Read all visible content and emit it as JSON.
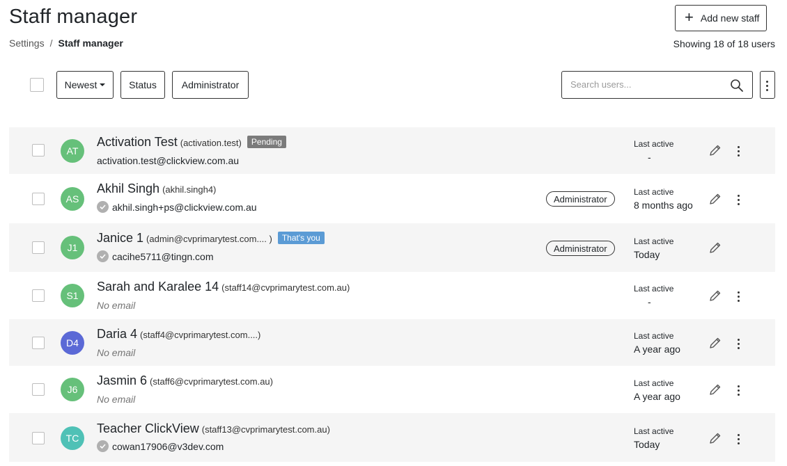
{
  "header": {
    "title": "Staff manager",
    "breadcrumb": {
      "parent": "Settings",
      "separator": "/",
      "current": "Staff manager"
    },
    "add_button": {
      "icon": "plus-icon",
      "label": "Add new staff"
    },
    "showing": "Showing 18 of 18 users"
  },
  "toolbar": {
    "sort_label": "Newest",
    "status_label": "Status",
    "admin_label": "Administrator",
    "search_placeholder": "Search users..."
  },
  "colors": {
    "avatar_green": "#66c07a",
    "avatar_blue": "#5b69d6",
    "avatar_teal": "#4fc1b6",
    "pending_tag": "#7b7b7b",
    "you_tag": "#5b9bd5",
    "row_shade": "#f5f5f5"
  },
  "users": [
    {
      "initials": "AT",
      "name": "Activation Test",
      "username": "(activation.test)",
      "tag": "Pending",
      "email": "activation.test@clickview.com.au",
      "verified": false,
      "no_email": false,
      "role": "",
      "last_active_label": "Last active",
      "last_active": "-"
    },
    {
      "initials": "AS",
      "name": "Akhil Singh",
      "username": "(akhil.singh4)",
      "tag": "",
      "email": "akhil.singh+ps@clickview.com.au",
      "verified": true,
      "no_email": false,
      "role": "Administrator",
      "last_active_label": "Last active",
      "last_active": "8 months ago"
    },
    {
      "initials": "J1",
      "name": "Janice 1",
      "username": "(admin@cvprimarytest.com.... )",
      "tag": "That's you",
      "email": "cacihe5711@tingn.com",
      "verified": true,
      "no_email": false,
      "role": "Administrator",
      "last_active_label": "Last active",
      "last_active": "Today"
    },
    {
      "initials": "S1",
      "name": "Sarah and Karalee 14",
      "username": "(staff14@cvprimarytest.com.au)",
      "tag": "",
      "email": "No email",
      "verified": false,
      "no_email": true,
      "role": "",
      "last_active_label": "Last active",
      "last_active": "-"
    },
    {
      "initials": "D4",
      "name": "Daria 4",
      "username": "(staff4@cvprimarytest.com....)",
      "tag": "",
      "email": "No email",
      "verified": false,
      "no_email": true,
      "role": "",
      "last_active_label": "Last active",
      "last_active": "A year ago"
    },
    {
      "initials": "J6",
      "name": "Jasmin 6",
      "username": "(staff6@cvprimarytest.com.au)",
      "tag": "",
      "email": "No email",
      "verified": false,
      "no_email": true,
      "role": "",
      "last_active_label": "Last active",
      "last_active": "A year ago"
    },
    {
      "initials": "TC",
      "name": "Teacher ClickView",
      "username": "(staff13@cvprimarytest.com.au)",
      "tag": "",
      "email": "cowan17906@v3dev.com",
      "verified": true,
      "no_email": false,
      "role": "",
      "last_active_label": "Last active",
      "last_active": "Today"
    }
  ]
}
